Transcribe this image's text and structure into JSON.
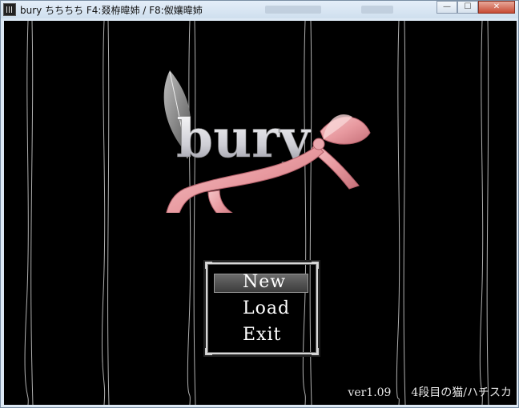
{
  "window": {
    "title": "bury ちちちち F4:叕栫暐姉 / F8:伮孃暐姉",
    "controls": {
      "minimize": "—",
      "maximize": "☐",
      "close": "✕"
    }
  },
  "title_screen": {
    "logo_text": "bury",
    "menu": {
      "items": [
        "New",
        "Load",
        "Exit"
      ],
      "selected": "New"
    },
    "version": "ver1.09",
    "credit": "4段目の猫/ハチスカ"
  }
}
